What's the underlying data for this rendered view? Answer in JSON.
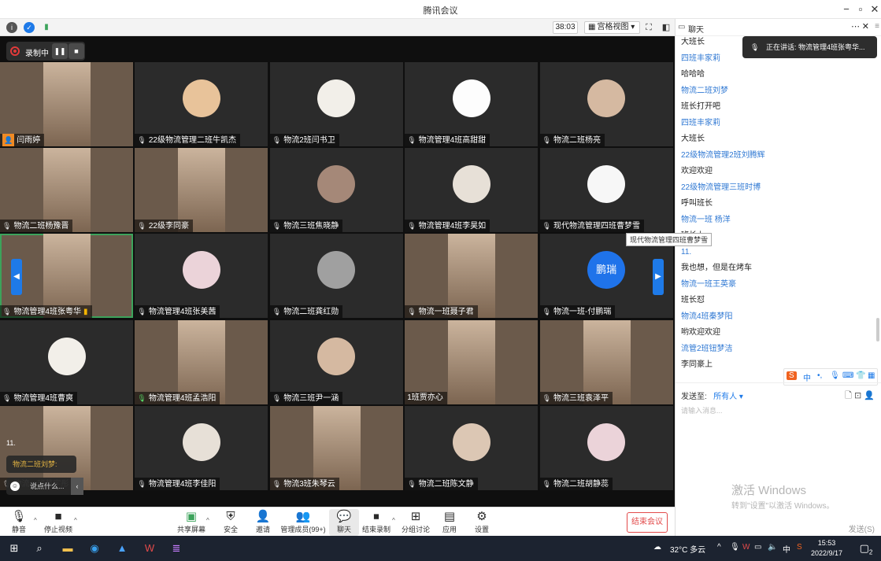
{
  "window": {
    "title": "腾讯会议"
  },
  "meeting_bar": {
    "timer": "38:03",
    "view_label": "宫格视图"
  },
  "recording": {
    "label": "录制中"
  },
  "tooltip": "现代物流管理四班曹梦雪",
  "tiles": [
    {
      "name": "闫雨婷",
      "cam": true,
      "host": true
    },
    {
      "name": "22级物流管理二班牛凯杰"
    },
    {
      "name": "物流2班闫书卫"
    },
    {
      "name": "物流管理4班高甜甜"
    },
    {
      "name": "物流二班杨亮"
    },
    {
      "name": "物流二班杨豫晋",
      "cam": true
    },
    {
      "name": "22级李同豪",
      "cam": true
    },
    {
      "name": "物流三班焦晓静"
    },
    {
      "name": "物流管理4班李昊如"
    },
    {
      "name": "现代物流管理四班曹梦雪"
    },
    {
      "name": "物流管理4班张粤华",
      "cam": true,
      "speaking": true
    },
    {
      "name": "物流管理4班张美茜"
    },
    {
      "name": "物流二班龚红勋"
    },
    {
      "name": "物流一班聂子君",
      "cam": true
    },
    {
      "name": "物流一班-付鹏瑞",
      "avatar_text": "鹏瑞"
    },
    {
      "name": "物流管理4班曹爽"
    },
    {
      "name": "物流管理4班孟浩阳",
      "cam": true,
      "mic_on": true
    },
    {
      "name": "物流三班尹一涵"
    },
    {
      "name": "1班贾亦心",
      "cam": true,
      "nomic": true
    },
    {
      "name": "物流三班袁泽平",
      "cam": true
    },
    {
      "name": "物流一班葛宇彤",
      "cam": true
    },
    {
      "name": "物流管理4班李佳阳"
    },
    {
      "name": "物流3班朱琴云",
      "cam": true
    },
    {
      "name": "物流二班陈文静"
    },
    {
      "name": "物流二班胡静蕊"
    }
  ],
  "float_chat": {
    "count": "11.",
    "sender": "物流二班刘梦:",
    "placeholder": "说点什么..."
  },
  "toolbar": {
    "mute": "静音",
    "stop_video": "停止视频",
    "share": "共享屏幕",
    "security": "安全",
    "invite": "邀请",
    "members": "管理成员(99+)",
    "chat": "聊天",
    "end_record": "结束录制",
    "breakout": "分组讨论",
    "apps": "应用",
    "settings": "设置",
    "end_meeting": "结束会议"
  },
  "chat": {
    "title": "聊天",
    "speaking": "正在讲话: 物流管理4班张粤华...",
    "messages": [
      {
        "kind": "text",
        "v": "大班长"
      },
      {
        "kind": "sender",
        "v": "四班丰家莉"
      },
      {
        "kind": "text",
        "v": "哈哈哈"
      },
      {
        "kind": "sender",
        "v": "物流二班刘梦"
      },
      {
        "kind": "text",
        "v": "班长打开吧"
      },
      {
        "kind": "sender",
        "v": "四班丰家莉"
      },
      {
        "kind": "text",
        "v": "大班长"
      },
      {
        "kind": "sender",
        "v": "22级物流管理2班刘腾辉"
      },
      {
        "kind": "text",
        "v": "欢迎欢迎"
      },
      {
        "kind": "sender",
        "v": "22级物流管理三班时博"
      },
      {
        "kind": "text",
        "v": "呼叫班长"
      },
      {
        "kind": "sender",
        "v": "物流一班 杨洋"
      },
      {
        "kind": "text",
        "v": "班长上"
      },
      {
        "kind": "sender",
        "v": "11."
      },
      {
        "kind": "text",
        "v": "我也想，但是在烤车"
      },
      {
        "kind": "sender",
        "v": "物流一班王英豪"
      },
      {
        "kind": "text",
        "v": "班长怼"
      },
      {
        "kind": "sender",
        "v": "物流4班秦梦阳"
      },
      {
        "kind": "text",
        "v": "哟欢迎欢迎"
      },
      {
        "kind": "sender",
        "v": "流管2班钮梦洁"
      },
      {
        "kind": "text",
        "v": "李同豪上"
      }
    ],
    "send_to_label": "发送至:",
    "send_to_value": "所有人",
    "input_placeholder": "请输入消息...",
    "send_button": "发送(S)"
  },
  "watermark": {
    "line1": "激活 Windows",
    "line2": "转到\"设置\"以激活 Windows。"
  },
  "taskbar": {
    "weather": "32°C 多云",
    "ime_lang": "中",
    "time": "15:53",
    "date": "2022/9/17",
    "notif_count": "2"
  },
  "colors": {
    "accent": "#1e7ae8",
    "end_red": "#e24a4a",
    "sender_blue": "#2f78d3"
  }
}
